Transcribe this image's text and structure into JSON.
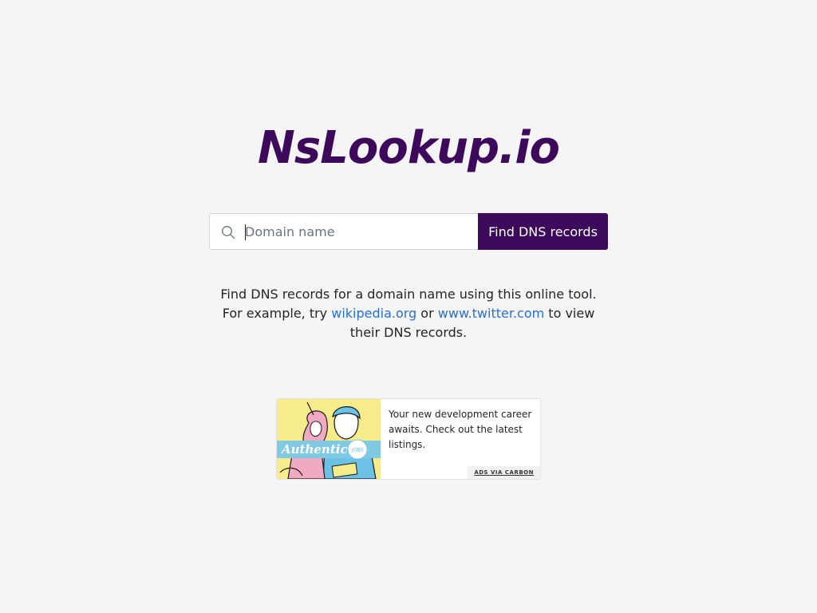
{
  "brand": {
    "logo_text": "NsLookup.io",
    "color": "#3d0a5b"
  },
  "search": {
    "icon": "search-icon",
    "placeholder": "Domain name",
    "value": "",
    "button_label": "Find DNS records"
  },
  "intro": {
    "text_1": "Find DNS records for a domain name using this online tool. For example, try ",
    "link_1": "wikipedia.org",
    "text_2": " or ",
    "link_2": "www.twitter.com",
    "text_3": " to view their DNS records.",
    "link_color": "#2a6fd6"
  },
  "ad": {
    "image_text": "Authentic",
    "image_badge": "JOBS",
    "text": "Your new development career awaits. Check out the latest listings.",
    "via_label": "ADS VIA CARBON"
  }
}
